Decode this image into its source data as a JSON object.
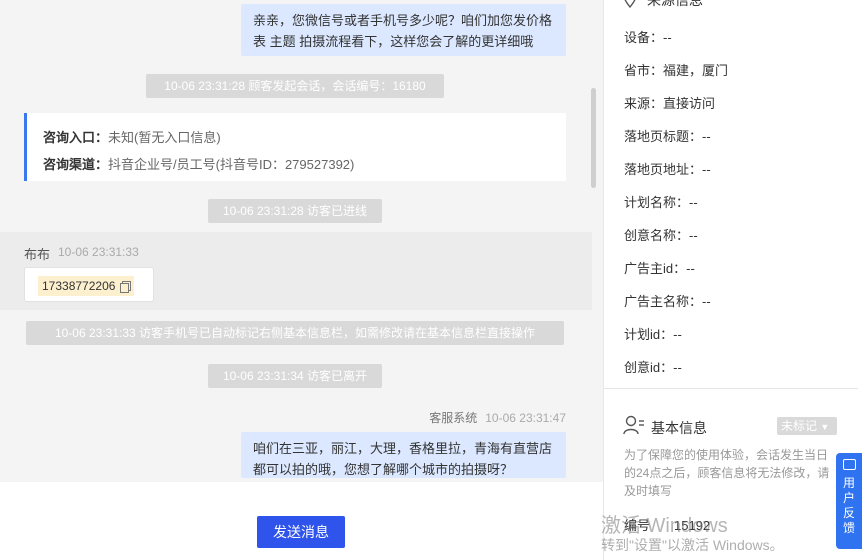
{
  "chat": {
    "msg_top": "亲亲，您微信号或者手机号多少呢？咱们加您发价格表 主题 拍摄流程看下，这样您会了解的更详细哦",
    "sys_start": "10-06 23:31:28 顾客发起会话，会话编号：16180",
    "info_card": {
      "entry_label": "咨询入口：",
      "entry_value": "未知(暂无入口信息)",
      "channel_label": "咨询渠道：",
      "channel_value": "抖音企业号/员工号(抖音号ID：279527392)"
    },
    "sys_enter": "10-06 23:31:28 访客已进线",
    "visitor": {
      "name": "布布",
      "time": "10-06 23:31:33",
      "phone": "17338772206"
    },
    "sys_marked": "10-06 23:31:33 访客手机号已自动标记右侧基本信息栏，如需修改请在基本信息栏直接操作",
    "sys_left": "10-06 23:31:34 访客已离开",
    "agent": {
      "name": "客服系统",
      "time": "10-06 23:31:47"
    },
    "msg_bottom": "咱们在三亚，丽江，大理，香格里拉，青海有直营店都可以拍的哦，您想了解哪个城市的拍摄呀？"
  },
  "composer": {
    "send_label": "发送消息"
  },
  "side": {
    "source_title": "来源信息",
    "source_rows": [
      {
        "label": "设备：",
        "value": "--"
      },
      {
        "label": "省市：",
        "value": "福建，厦门"
      },
      {
        "label": "来源：",
        "value": "直接访问"
      },
      {
        "label": "落地页标题：",
        "value": "--"
      },
      {
        "label": "落地页地址：",
        "value": "--"
      },
      {
        "label": "计划名称：",
        "value": "--"
      },
      {
        "label": "创意名称：",
        "value": "--"
      },
      {
        "label": "广告主id：",
        "value": "--"
      },
      {
        "label": "广告主名称：",
        "value": "--"
      },
      {
        "label": "计划id：",
        "value": "--"
      },
      {
        "label": "创意id：",
        "value": "--"
      }
    ],
    "basic_title": "基本信息",
    "tag_label": "未标记",
    "notice": "为了保障您的使用体验，会话发生当日的24点之后，顾客信息将无法修改，请及时填写",
    "id_label": "编号",
    "id_value": "15192"
  },
  "feedback": {
    "label": "用户反馈"
  },
  "watermark": {
    "title": "激活 Windows",
    "sub": "转到\"设置\"以激活 Windows。"
  },
  "colors": {
    "accent": "#2f54eb",
    "bubble": "#dbe8ff",
    "card_border": "#3a78f2"
  },
  "icons": [
    "location-icon",
    "copy-icon",
    "user-info-icon",
    "caret-down-icon",
    "feedback-chat-icon"
  ]
}
